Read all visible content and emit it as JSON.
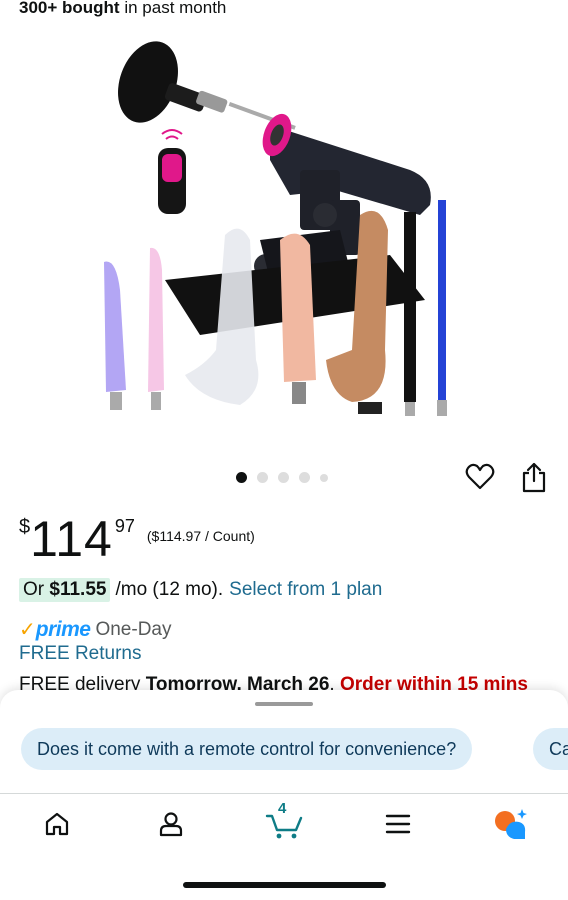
{
  "social_proof": {
    "count": "300+ bought",
    "suffix": " in past month"
  },
  "image": {
    "indicator_count": 5,
    "active_index": 0
  },
  "price": {
    "symbol": "$",
    "whole": "114",
    "fraction": "97",
    "unit_price": "($114.97 / Count)"
  },
  "plan": {
    "prefix": "Or ",
    "amount": "$11.55",
    "terms": "/mo (12 mo).",
    "link": "Select from 1 plan"
  },
  "prime": {
    "check": "✓",
    "brand": "prime",
    "speed": "One-Day"
  },
  "returns": "FREE Returns",
  "delivery": {
    "prefix": "FREE delivery ",
    "date": "Tomorrow, March 26",
    "sep": ". ",
    "cutoff": "Order within 15 mins"
  },
  "suggestions": [
    "Does it come with a remote control for convenience?",
    "Ca"
  ],
  "nav": {
    "cart_count": "4",
    "items": [
      "home-icon",
      "account-icon",
      "cart-icon",
      "menu-icon",
      "rufus-icon"
    ]
  },
  "colors": {
    "link": "#1f6b8f",
    "prime_blue": "#1a98ff",
    "prime_check": "#f7a400",
    "urgent_red": "#c40000",
    "teal": "#0e7c86",
    "chip_bg": "#dcedf8",
    "plan_highlight": "#d9f2e6"
  }
}
